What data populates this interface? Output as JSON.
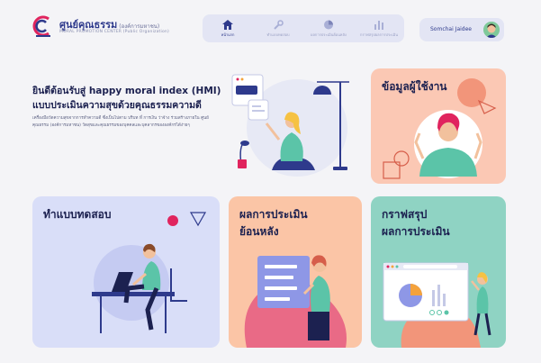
{
  "brand": {
    "title": "ศูนย์คุณธรรม",
    "title_small": "(องค์การมหาชน)",
    "subtitle": "MORAL PROMOTION CENTER (Public Organization)"
  },
  "nav": {
    "items": [
      {
        "label": "หน้าแรก",
        "icon": "home-icon",
        "active": true
      },
      {
        "label": "ทำแบบทดสอบ",
        "icon": "tools-icon",
        "active": false
      },
      {
        "label": "ผลการประเมินย้อนหลัง",
        "icon": "history-icon",
        "active": false
      },
      {
        "label": "กราฟสรุปผลการประเมิน",
        "icon": "chart-icon",
        "active": false
      }
    ]
  },
  "user": {
    "name": "Somchai Jaidee"
  },
  "welcome": {
    "line1": "ยินดีต้อนรับสู่ happy moral index (HMI)",
    "line2": "แบบประเมินความสุขด้วยคุณธรรมความดี",
    "description": "เครื่องมือวัดความสุขจากการทำความดี ซึ่งเป็นไปตาม บริบท ที่ การเงิน ว่าจ้าง ร่วมสร้างภายใน ศูนย์คุณธรรม (องค์การมหาชน) วัดสุขและคุณธรรมของบุคคลและบุคลากรขององค์กรได้ง่ายๆ"
  },
  "cards": {
    "profile": "ข้อมูลผู้ใช้งาน",
    "test": "ทำแบบทดสอบ",
    "history_line1": "ผลการประเมิน",
    "history_line2": "ย้อนหลัง",
    "graph_line1": "กราฟสรุป",
    "graph_line2": "ผลการประเมิน"
  },
  "colors": {
    "navy": "#2e3a8c",
    "profile_card": "#fbc8b4",
    "test_card": "#d9def8",
    "history_card": "#fbc5a6",
    "graph_card": "#8fd3c3"
  }
}
